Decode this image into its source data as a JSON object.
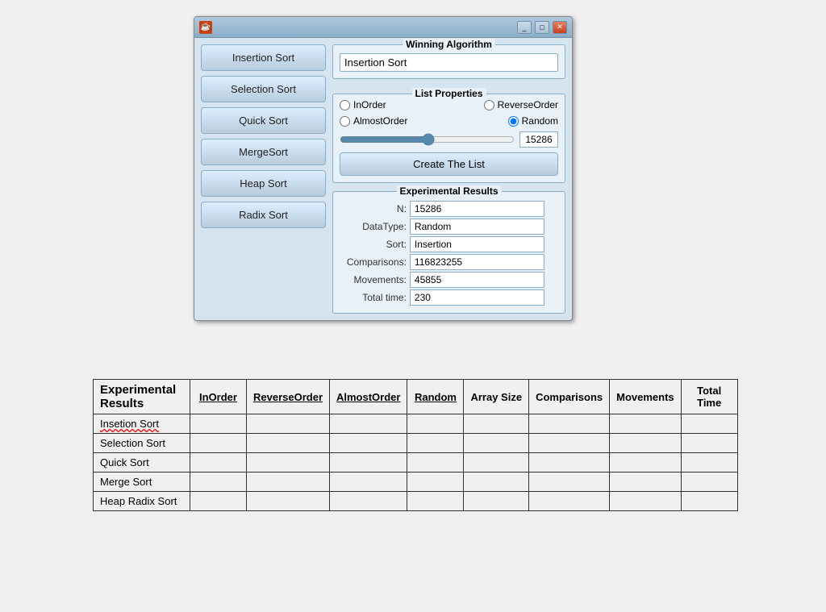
{
  "window": {
    "title": "",
    "icon_label": "☕",
    "winning_algorithm": {
      "label": "Winning Algorithm",
      "value": "Insertion Sort"
    },
    "list_properties": {
      "label": "List Properties",
      "radio_options": [
        {
          "id": "inorder",
          "label": "InOrder",
          "checked": false
        },
        {
          "id": "reverseorder",
          "label": "ReverseOrder",
          "checked": false
        },
        {
          "id": "almostorder",
          "label": "AlmostOrder",
          "checked": false
        },
        {
          "id": "random",
          "label": "Random",
          "checked": true
        }
      ],
      "slider_value": "15286",
      "create_button": "Create The List"
    },
    "experimental_results": {
      "label": "Experimental Results",
      "fields": [
        {
          "label": "N:",
          "value": "15286"
        },
        {
          "label": "DataType:",
          "value": "Random"
        },
        {
          "label": "Sort:",
          "value": "Insertion"
        },
        {
          "label": "Comparisons:",
          "value": "116823255"
        },
        {
          "label": "Movements:",
          "value": "45855"
        },
        {
          "label": "Total time:",
          "value": "230"
        }
      ]
    },
    "sort_buttons": [
      "Insertion Sort",
      "Selection Sort",
      "Quick Sort",
      "MergeSort",
      "Heap Sort",
      "Radix Sort"
    ]
  },
  "bottom_table": {
    "header_line1": "Experimental",
    "header_line2": "Results",
    "columns": [
      "InOrder",
      "ReverseOrder",
      "AlmostOrder",
      "Random",
      "Array Size",
      "Comparisons",
      "Movements",
      "Total Time"
    ],
    "rows": [
      {
        "label": "Insetion Sort",
        "squiggly": true
      },
      {
        "label": "Selection Sort",
        "squiggly": false
      },
      {
        "label": "Quick Sort",
        "squiggly": false
      },
      {
        "label": "Merge Sort",
        "squiggly": false
      },
      {
        "label": "Heap Radix Sort",
        "squiggly": false
      }
    ]
  }
}
